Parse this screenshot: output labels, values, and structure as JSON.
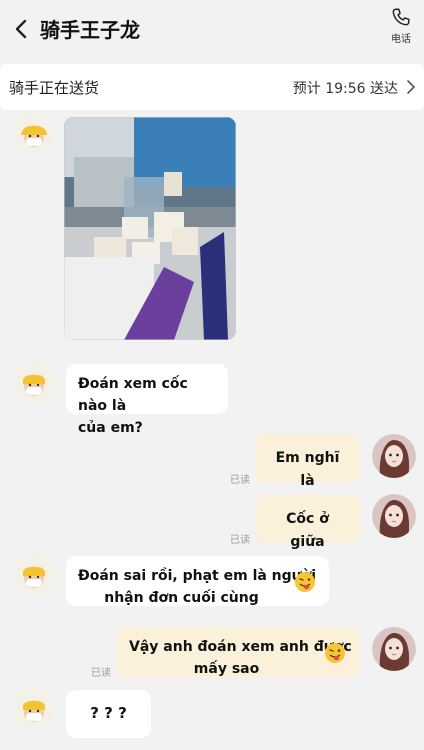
{
  "header": {
    "title": "骑手王子龙",
    "phone_label": "电话"
  },
  "status": {
    "text": "骑手正在送货",
    "eta": "预计 19:56 送达"
  },
  "messages": {
    "m1": {
      "line1": "Đoán xem cốc nào là",
      "line2": "của em?"
    },
    "m2": {
      "text": "Em nghĩ là",
      "read": "已读"
    },
    "m3": {
      "text": "Cốc ở giữa",
      "read": "已读"
    },
    "m4": {
      "line1": "Đoán sai rồi, phạt em là người",
      "line2": "nhận đơn cuối cùng"
    },
    "m5": {
      "line1": "Vậy anh đoán xem anh được",
      "line2": "mấy sao",
      "read": "已读"
    },
    "m6": {
      "text": "? ? ?"
    }
  },
  "icons": {
    "back": "back-chevron-icon",
    "phone": "phone-icon",
    "emoji": "tongue-wink-emoji"
  }
}
